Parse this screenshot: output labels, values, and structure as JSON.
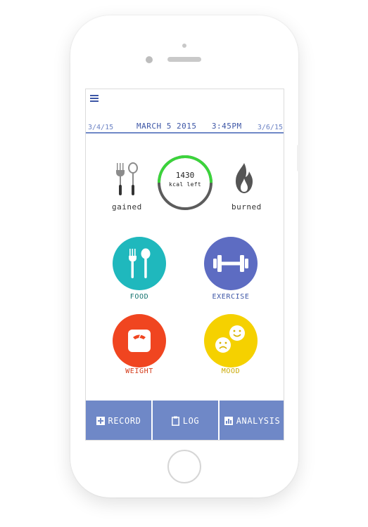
{
  "header": {
    "prev_date": "3/4/15",
    "current_date": "MARCH 5 2015   3:45PM",
    "next_date": "3/6/15"
  },
  "summary": {
    "gained_label": "gained",
    "burned_label": "burned",
    "kcal_value": "1430",
    "kcal_label": "kcal left",
    "kcal_progress": 0.5
  },
  "tiles": {
    "food": "FOOD",
    "exercise": "EXERCISE",
    "weight": "WEIGHT",
    "mood": "MOOD"
  },
  "tabs": {
    "record": "RECORD",
    "log": "LOG",
    "analysis": "ANALYSIS"
  },
  "colors": {
    "accent": "#3d56a6",
    "tab_bar": "#6f88c7",
    "food": "#1fb8bd",
    "exercise": "#5d6cc2",
    "weight": "#f04520",
    "mood": "#f5d100",
    "ring_done": "#3bd43b",
    "ring_remaining": "#5c5c5c"
  },
  "icons": {
    "menu": "hamburger-menu-icon",
    "gained": "fork-spoon-icon",
    "burned": "flame-icon",
    "food": "fork-spoon-icon",
    "exercise": "dumbbell-icon",
    "weight": "scale-icon",
    "mood": "faces-icon",
    "record": "plus-square-icon",
    "log": "clipboard-icon",
    "analysis": "bar-chart-icon"
  }
}
